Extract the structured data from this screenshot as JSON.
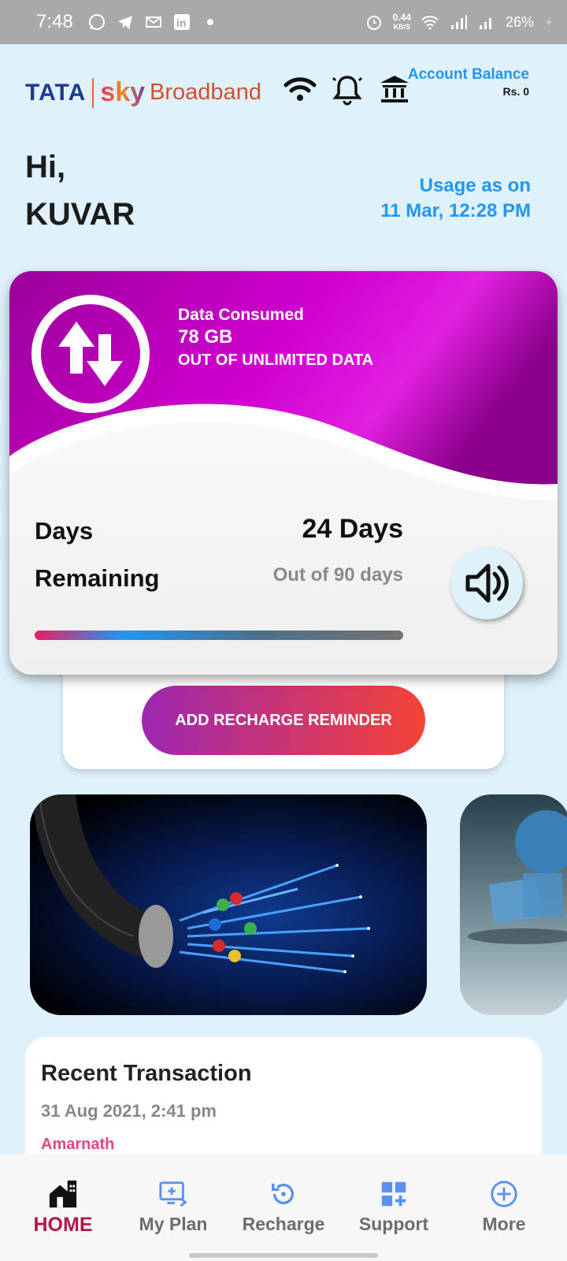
{
  "status_bar": {
    "time": "7:48",
    "speed_value": "0.44",
    "speed_unit": "KB/S",
    "battery": "26%"
  },
  "header": {
    "logo_tata": "TATA",
    "logo_sky": "sky",
    "logo_broadband": "Broadband",
    "balance_label": "Account Balance",
    "balance_value": "Rs. 0",
    "icons": [
      "wifi-icon",
      "bell-icon",
      "bank-icon"
    ]
  },
  "greeting": {
    "hi": "Hi,",
    "name": "KUVAR",
    "usage_label": "Usage as on",
    "usage_date": "11 Mar, 12:28 PM"
  },
  "data_card": {
    "consumed_label": "Data Consumed",
    "consumed_value": "78 GB",
    "plan_text": "OUT OF UNLIMITED DATA",
    "days_label_1": "Days",
    "days_label_2": "Remaining",
    "days_value": "24 Days",
    "days_total": "Out of 90 days",
    "days_remaining_fraction": 1.0,
    "accent_start": "#e91e63",
    "accent_mid": "#2196f3"
  },
  "reminder_button": "ADD RECHARGE REMINDER",
  "recent_transaction": {
    "title": "Recent Transaction",
    "date": "31 Aug 2021, 2:41 pm",
    "name": "Amarnath"
  },
  "bottom_nav": {
    "items": [
      {
        "label": "HOME",
        "icon": "home-icon",
        "active": true
      },
      {
        "label": "My Plan",
        "icon": "plan-icon",
        "active": false
      },
      {
        "label": "Recharge",
        "icon": "recharge-icon",
        "active": false
      },
      {
        "label": "Support",
        "icon": "support-icon",
        "active": false
      },
      {
        "label": "More",
        "icon": "more-icon",
        "active": false
      }
    ]
  },
  "colors": {
    "background": "#dff1fb",
    "accent_blue": "#2196f3",
    "active_nav": "#b3174a",
    "card_magenta": "#b400b4"
  }
}
